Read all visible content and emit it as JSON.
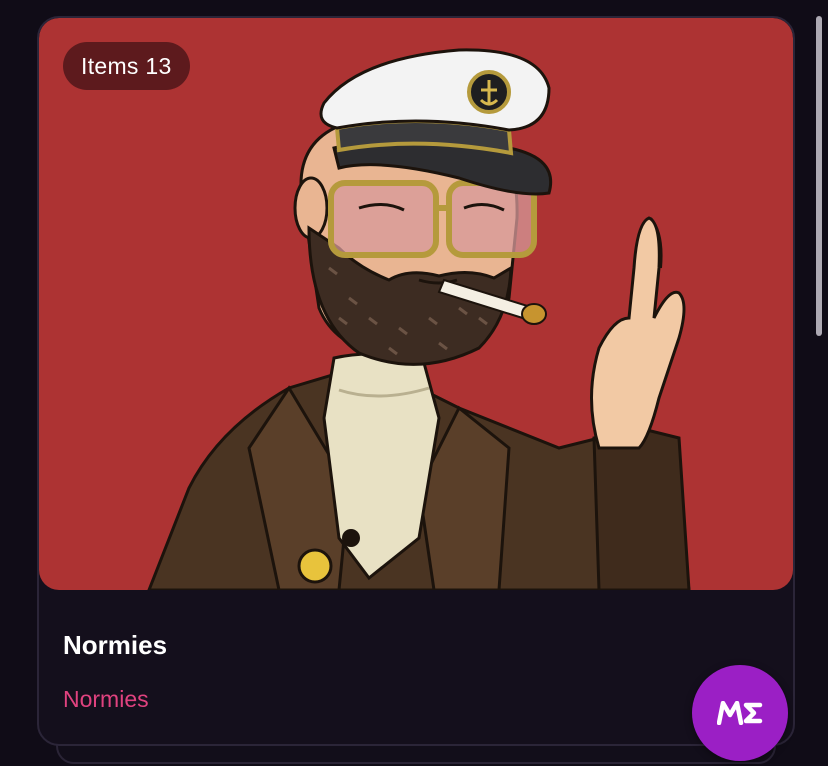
{
  "card": {
    "badge_label": "Items 13",
    "title": "Normies",
    "collection": "Normies",
    "image_alt": "Bearded sailor captain with cigarette and crossed fingers"
  },
  "fab": {
    "icon": "magic-eden-logo-icon",
    "brand_color": "#9b1fc5"
  },
  "colors": {
    "background": "#100c17",
    "art_background": "#ad3333",
    "collection_text": "#e0427f"
  }
}
